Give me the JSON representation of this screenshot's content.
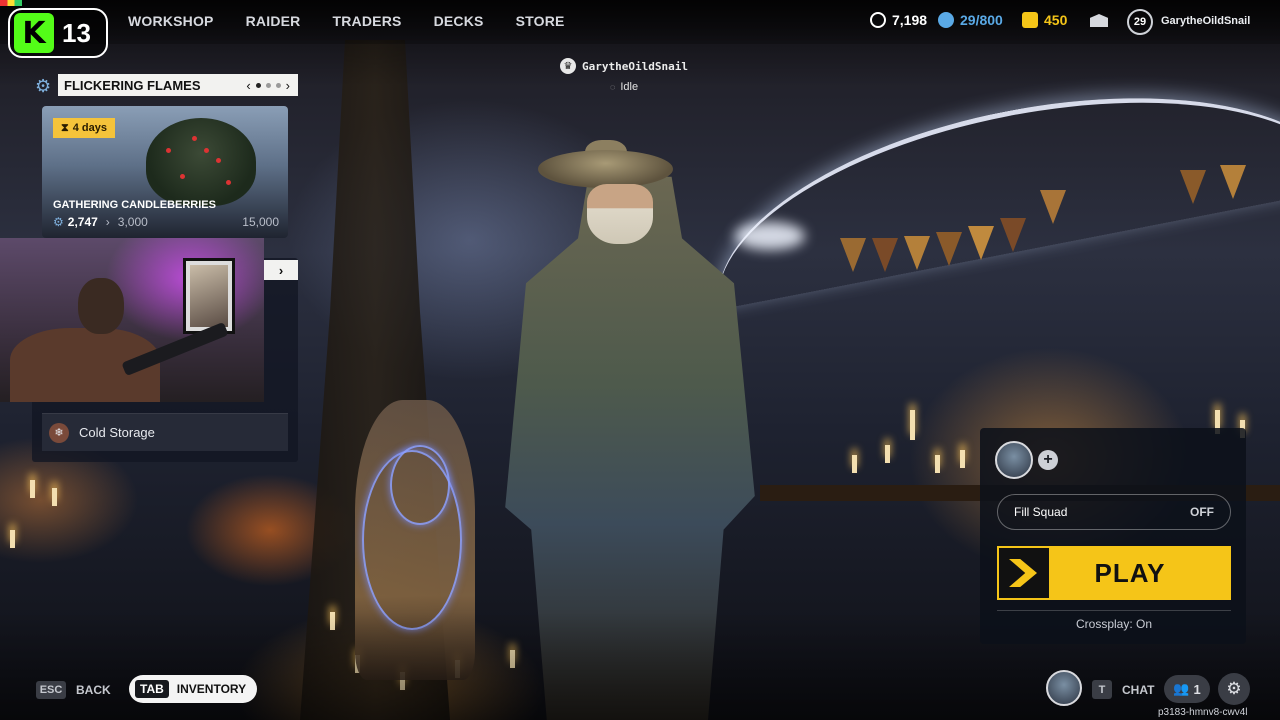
{
  "streamer": {
    "platform_letter": "K",
    "viewer_count": "13"
  },
  "nav": {
    "items": [
      {
        "label": "WORKSHOP"
      },
      {
        "label": "RAIDER"
      },
      {
        "label": "TRADERS"
      },
      {
        "label": "DECKS"
      },
      {
        "label": "STORE"
      }
    ]
  },
  "currencies": [
    {
      "icon": "raider-token-icon",
      "value": "7,198",
      "color": "#ffffff"
    },
    {
      "icon": "coin-stack-icon",
      "value": "29/800",
      "color": "#5aa9e6"
    },
    {
      "icon": "cred-icon",
      "value": "450",
      "color": "#f5c518"
    }
  ],
  "profile": {
    "level": "29",
    "username": "GarytheOildSnail"
  },
  "event": {
    "title": "FLICKERING FLAMES",
    "pager_total": 3,
    "pager_active": 1,
    "card": {
      "timer": "4 days",
      "title": "GATHERING CANDLEBERRIES",
      "progress_current": "2,747",
      "progress_next": "3,000",
      "progress_max": "15,000"
    }
  },
  "loadout": {
    "storage_label": "Cold Storage"
  },
  "player": {
    "name": "GarytheOildSnail",
    "status": "Idle"
  },
  "play_panel": {
    "fill_squad_label": "Fill Squad",
    "fill_squad_value": "OFF",
    "play_label": "PLAY",
    "crossplay": "Crossplay: On"
  },
  "bottom": {
    "esc_key": "ESC",
    "back_label": "BACK",
    "tab_key": "TAB",
    "inventory_label": "INVENTORY",
    "chat_key": "T",
    "chat_label": "CHAT",
    "friends_count": "1",
    "session_id": "p3183-hmnv8-cwv4l"
  }
}
